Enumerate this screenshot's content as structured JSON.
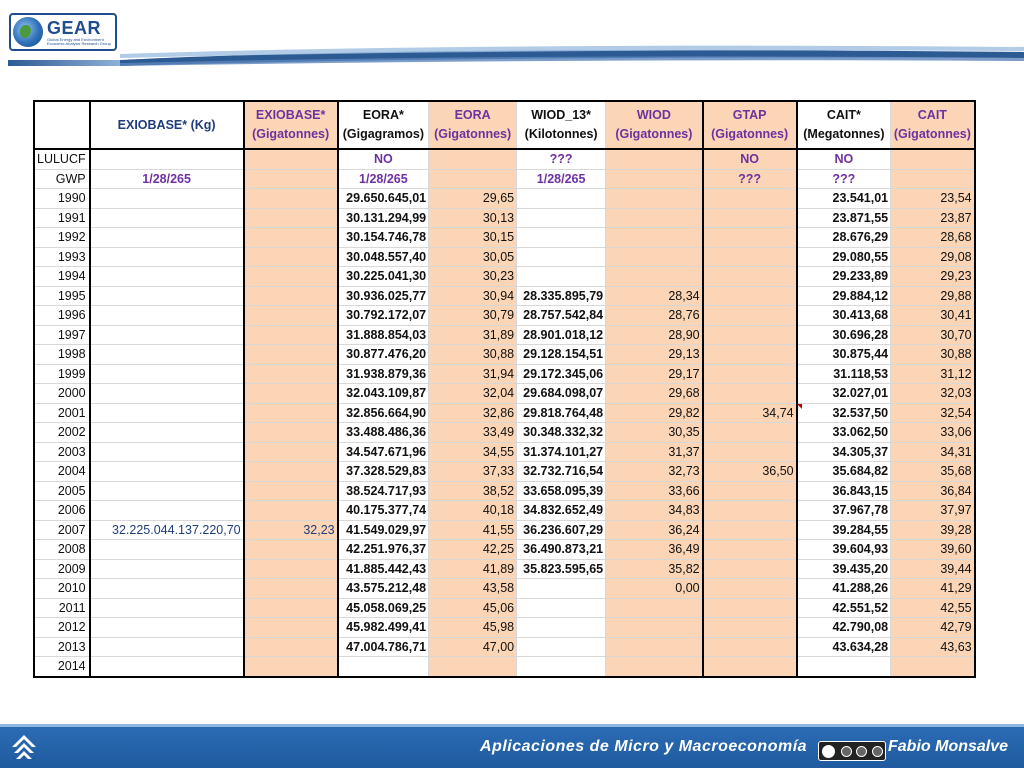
{
  "header": {
    "logo_name": "GEAR",
    "logo_subtitle": "Global Energy and Environment Economic Analysis Research Group"
  },
  "table": {
    "headers": [
      {
        "line1": "",
        "line2": ""
      },
      {
        "line1": "EXIOBASE* (Kg)",
        "line2": ""
      },
      {
        "line1": "EXIOBASE*",
        "line2": "(Gigatonnes)"
      },
      {
        "line1": "EORA*",
        "line2": "(Gigagramos)"
      },
      {
        "line1": "EORA",
        "line2": "(Gigatonnes)"
      },
      {
        "line1": "WIOD_13*",
        "line2": "(Kilotonnes)"
      },
      {
        "line1": "WIOD",
        "line2": "(Gigatonnes)"
      },
      {
        "line1": "GTAP",
        "line2": "(Gigatonnes)"
      },
      {
        "line1": "CAIT*",
        "line2": "(Megatonnes)"
      },
      {
        "line1": "CAIT",
        "line2": "(Gigatonnes)"
      }
    ],
    "lulucf": {
      "label": "LULUCF",
      "values": [
        "",
        "",
        "NO",
        "",
        "???",
        "",
        "NO",
        "NO",
        ""
      ]
    },
    "gwp": {
      "label": "GWP",
      "values": [
        "1/28/265",
        "",
        "1/28/265",
        "",
        "1/28/265",
        "",
        "???",
        "???",
        ""
      ]
    },
    "rows": [
      {
        "year": "1990",
        "v": [
          "",
          "",
          "29.650.645,01",
          "29,65",
          "",
          "",
          "",
          "23.541,01",
          "23,54"
        ]
      },
      {
        "year": "1991",
        "v": [
          "",
          "",
          "30.131.294,99",
          "30,13",
          "",
          "",
          "",
          "23.871,55",
          "23,87"
        ]
      },
      {
        "year": "1992",
        "v": [
          "",
          "",
          "30.154.746,78",
          "30,15",
          "",
          "",
          "",
          "28.676,29",
          "28,68"
        ]
      },
      {
        "year": "1993",
        "v": [
          "",
          "",
          "30.048.557,40",
          "30,05",
          "",
          "",
          "",
          "29.080,55",
          "29,08"
        ]
      },
      {
        "year": "1994",
        "v": [
          "",
          "",
          "30.225.041,30",
          "30,23",
          "",
          "",
          "",
          "29.233,89",
          "29,23"
        ]
      },
      {
        "year": "1995",
        "v": [
          "",
          "",
          "30.936.025,77",
          "30,94",
          "28.335.895,79",
          "28,34",
          "",
          "29.884,12",
          "29,88"
        ]
      },
      {
        "year": "1996",
        "v": [
          "",
          "",
          "30.792.172,07",
          "30,79",
          "28.757.542,84",
          "28,76",
          "",
          "30.413,68",
          "30,41"
        ]
      },
      {
        "year": "1997",
        "v": [
          "",
          "",
          "31.888.854,03",
          "31,89",
          "28.901.018,12",
          "28,90",
          "",
          "30.696,28",
          "30,70"
        ]
      },
      {
        "year": "1998",
        "v": [
          "",
          "",
          "30.877.476,20",
          "30,88",
          "29.128.154,51",
          "29,13",
          "",
          "30.875,44",
          "30,88"
        ]
      },
      {
        "year": "1999",
        "v": [
          "",
          "",
          "31.938.879,36",
          "31,94",
          "29.172.345,06",
          "29,17",
          "",
          "31.118,53",
          "31,12"
        ]
      },
      {
        "year": "2000",
        "v": [
          "",
          "",
          "32.043.109,87",
          "32,04",
          "29.684.098,07",
          "29,68",
          "",
          "32.027,01",
          "32,03"
        ]
      },
      {
        "year": "2001",
        "v": [
          "",
          "",
          "32.856.664,90",
          "32,86",
          "29.818.764,48",
          "29,82",
          "34,74",
          "32.537,50",
          "32,54"
        ]
      },
      {
        "year": "2002",
        "v": [
          "",
          "",
          "33.488.486,36",
          "33,49",
          "30.348.332,32",
          "30,35",
          "",
          "33.062,50",
          "33,06"
        ]
      },
      {
        "year": "2003",
        "v": [
          "",
          "",
          "34.547.671,96",
          "34,55",
          "31.374.101,27",
          "31,37",
          "",
          "34.305,37",
          "34,31"
        ]
      },
      {
        "year": "2004",
        "v": [
          "",
          "",
          "37.328.529,83",
          "37,33",
          "32.732.716,54",
          "32,73",
          "36,50",
          "35.684,82",
          "35,68"
        ]
      },
      {
        "year": "2005",
        "v": [
          "",
          "",
          "38.524.717,93",
          "38,52",
          "33.658.095,39",
          "33,66",
          "",
          "36.843,15",
          "36,84"
        ]
      },
      {
        "year": "2006",
        "v": [
          "",
          "",
          "40.175.377,74",
          "40,18",
          "34.832.652,49",
          "34,83",
          "",
          "37.967,78",
          "37,97"
        ]
      },
      {
        "year": "2007",
        "v": [
          "32.225.044.137.220,70",
          "32,23",
          "41.549.029,97",
          "41,55",
          "36.236.607,29",
          "36,24",
          "",
          "39.284,55",
          "39,28"
        ]
      },
      {
        "year": "2008",
        "v": [
          "",
          "",
          "42.251.976,37",
          "42,25",
          "36.490.873,21",
          "36,49",
          "",
          "39.604,93",
          "39,60"
        ]
      },
      {
        "year": "2009",
        "v": [
          "",
          "",
          "41.885.442,43",
          "41,89",
          "35.823.595,65",
          "35,82",
          "",
          "39.435,20",
          "39,44"
        ]
      },
      {
        "year": "2010",
        "v": [
          "",
          "",
          "43.575.212,48",
          "43,58",
          "",
          "0,00",
          "",
          "41.288,26",
          "41,29"
        ]
      },
      {
        "year": "2011",
        "v": [
          "",
          "",
          "45.058.069,25",
          "45,06",
          "",
          "",
          "",
          "42.551,52",
          "42,55"
        ]
      },
      {
        "year": "2012",
        "v": [
          "",
          "",
          "45.982.499,41",
          "45,98",
          "",
          "",
          "",
          "42.790,08",
          "42,79"
        ]
      },
      {
        "year": "2013",
        "v": [
          "",
          "",
          "47.004.786,71",
          "47,00",
          "",
          "",
          "",
          "43.634,28",
          "43,63"
        ]
      },
      {
        "year": "2014",
        "v": [
          "",
          "",
          "",
          "",
          "",
          "",
          "",
          "",
          ""
        ]
      }
    ]
  },
  "footer": {
    "title": "Aplicaciones de Micro y Macroeconomía",
    "license_icon": "cc-by-nc-sa-icon",
    "author": "Fabio Monsalve"
  },
  "colors": {
    "orange_column": "#fbd5b5",
    "purple_text": "#7030a0",
    "footer_blue": "#1f5a9e"
  }
}
